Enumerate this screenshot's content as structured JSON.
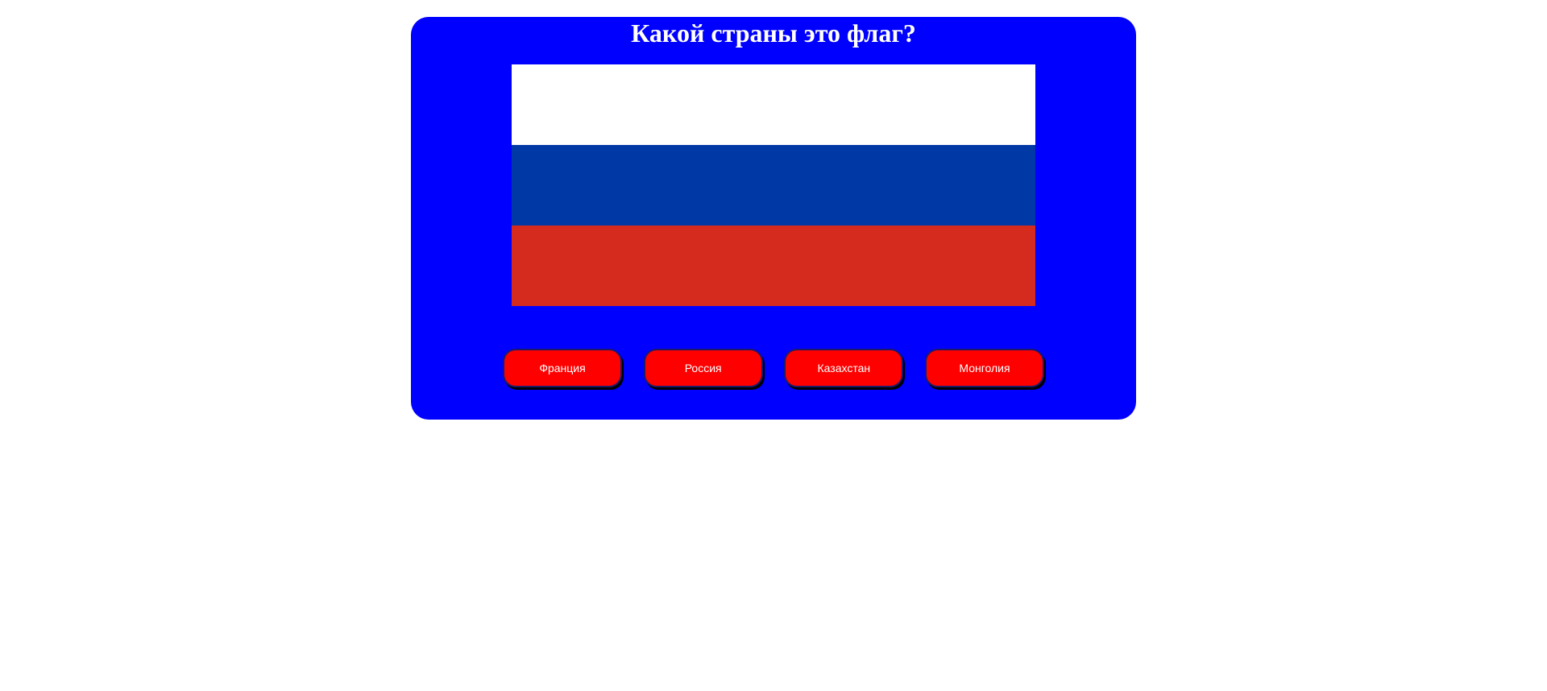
{
  "quiz": {
    "question": "Какой страны это флаг?",
    "flag": {
      "stripes": [
        "#ffffff",
        "#0039a6",
        "#d52b1e"
      ]
    },
    "answers": [
      {
        "label": "Франция"
      },
      {
        "label": "Россия"
      },
      {
        "label": "Казахстан"
      },
      {
        "label": "Монголия"
      }
    ]
  },
  "colors": {
    "card_background": "#0000ff",
    "button_background": "#ff0000",
    "text": "#ffffff"
  }
}
